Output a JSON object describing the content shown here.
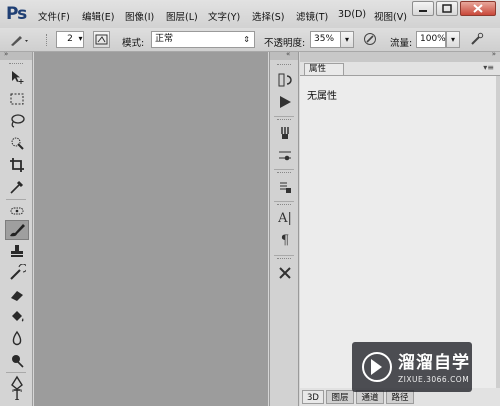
{
  "app": {
    "logo": "Ps",
    "menu": [
      "文件(F)",
      "编辑(E)",
      "图像(I)",
      "图层(L)",
      "文字(Y)",
      "选择(S)",
      "滤镜(T)",
      "3D(D)",
      "视图(V)"
    ],
    "window_buttons": [
      "minimize-icon",
      "maximize-icon",
      "close-icon"
    ]
  },
  "options": {
    "brush_size": "2",
    "mode_label": "模式:",
    "mode_value": "正常",
    "opacity_label": "不透明度:",
    "opacity_value": "35%",
    "flow_label": "流量:",
    "flow_value": "100%"
  },
  "tools": [
    "move-icon",
    "marquee-icon",
    "lasso-icon",
    "quick-select-icon",
    "crop-icon",
    "eyedropper-icon",
    "healing-brush-icon",
    "brush-icon",
    "clone-stamp-icon",
    "history-brush-icon",
    "eraser-icon",
    "paint-bucket-icon",
    "blur-icon",
    "dodge-icon",
    "pen-icon",
    "type-icon"
  ],
  "active_tool": "brush-icon",
  "dock_icons": [
    "history-icon",
    "actions-icon",
    "brush-presets-icon",
    "brush-settings-icon",
    "tool-presets-icon",
    "character-icon",
    "paragraph-icon",
    "tools-icon"
  ],
  "properties": {
    "tab_label": "属性",
    "empty_text": "无属性"
  },
  "bottom_tabs": [
    "3D",
    "图层",
    "通道",
    "路径"
  ],
  "watermark": {
    "name": "溜溜自学",
    "url": "ZIXUE.3066.COM"
  }
}
